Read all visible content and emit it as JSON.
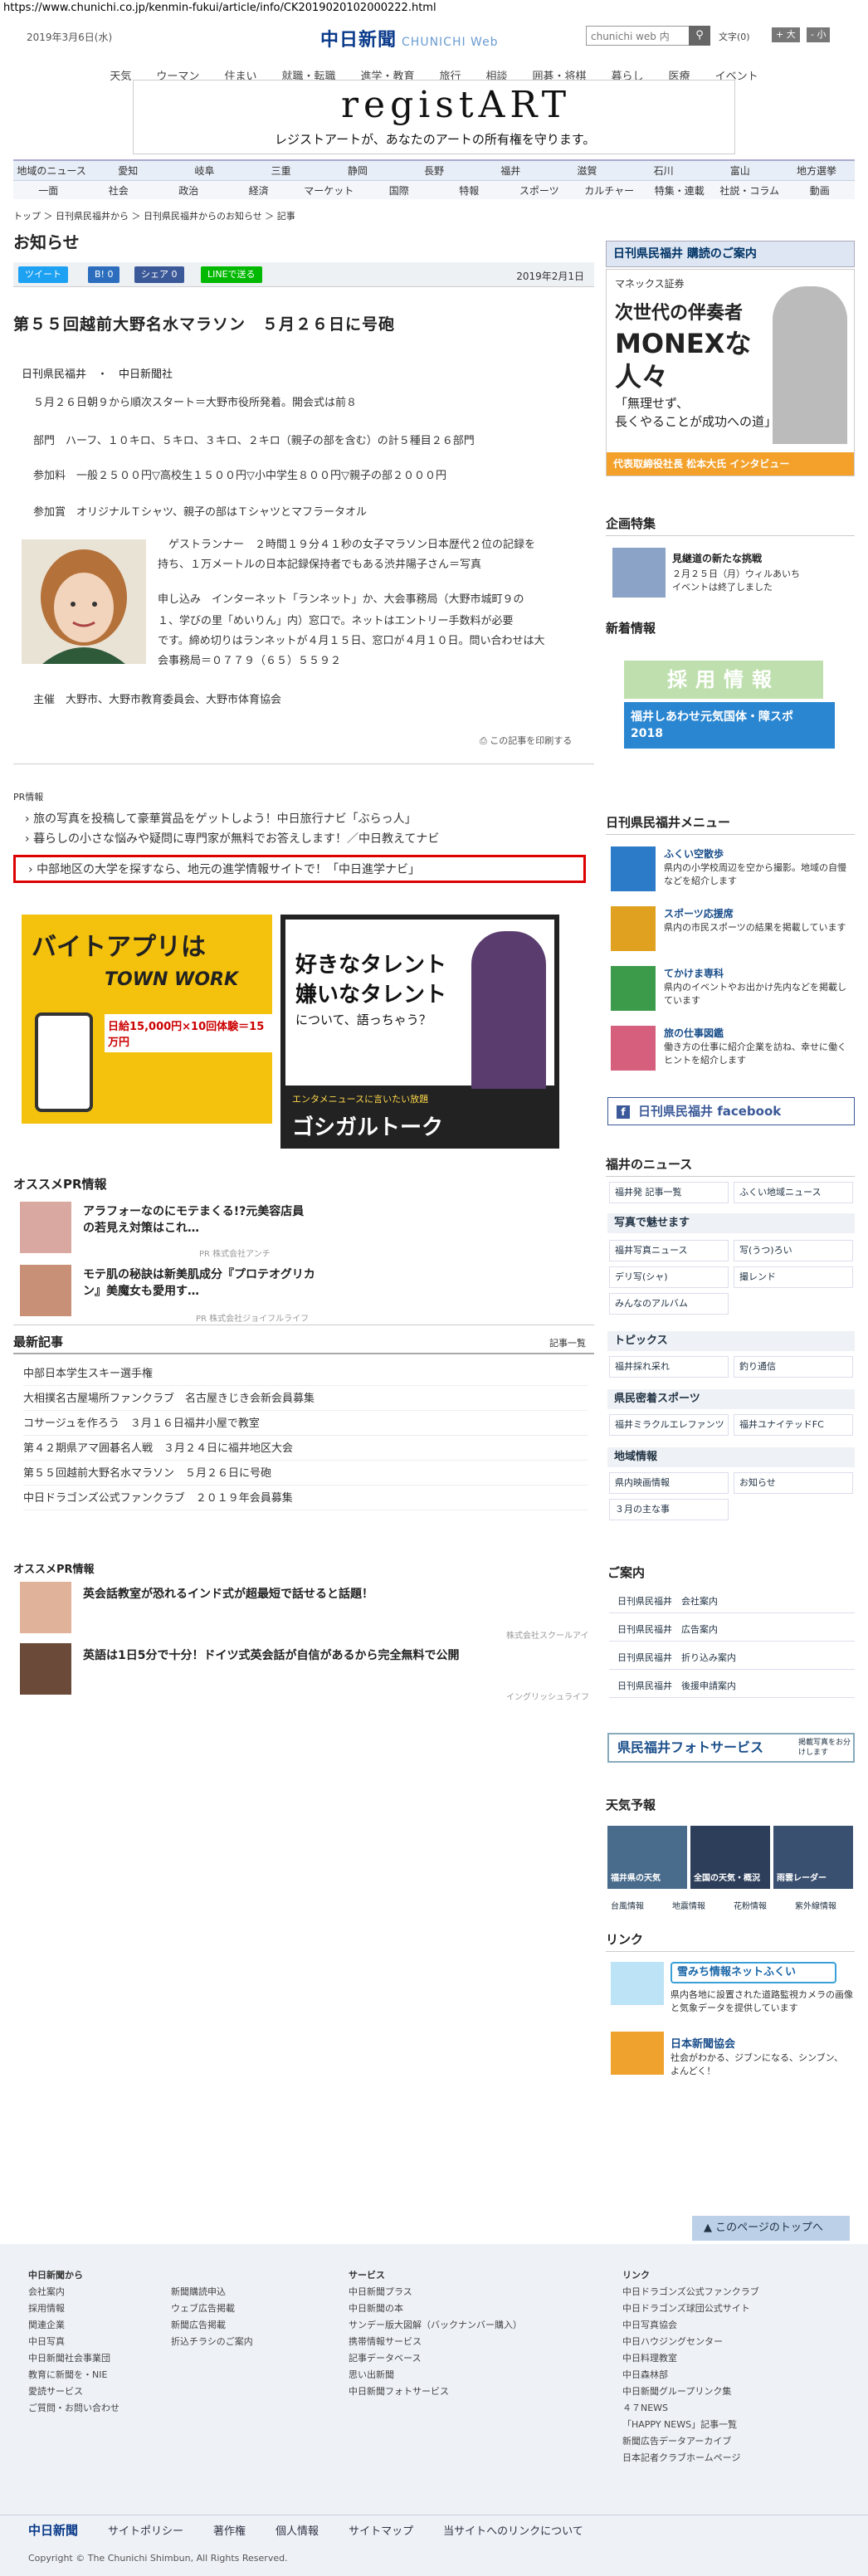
{
  "browser": {
    "url": "https://www.chunichi.co.jp/kenmin-fukui/article/info/CK2019020102000222.html"
  },
  "header": {
    "date": "2019年3月6日(水)",
    "logo": "中日新聞",
    "logo_sub": "CHUNICHI Web",
    "search_placeholder": "chunichi web 内",
    "font_label": "文字",
    "font_reset": "(0)",
    "font_big": "+ 大",
    "font_small": "- 小"
  },
  "gnav": [
    "天気",
    "ウーマン",
    "住まい",
    "就職・転職",
    "進学・教育",
    "旅行",
    "相談",
    "囲碁・将棋",
    "暮らし",
    "医療",
    "イベント"
  ],
  "ad": {
    "brand": "registART",
    "tagline": "レジストアートが、あなたのアートの所有権を守ります。"
  },
  "nav2_row1": [
    "地域のニュース",
    "愛知",
    "岐阜",
    "三重",
    "静岡",
    "長野",
    "福井",
    "滋賀",
    "石川",
    "富山",
    "地方選挙"
  ],
  "nav2_row2": [
    "一面",
    "社会",
    "政治",
    "経済",
    "マーケット",
    "国際",
    "特報",
    "スポーツ",
    "カルチャー",
    "特集・連載",
    "社説・コラム",
    "動画"
  ],
  "breadcrumb": "トップ ＞ 日刊県民福井から ＞ 日刊県民福井からのお知らせ ＞ 記事",
  "page_title": "お知らせ",
  "share": {
    "tweet": "ツイート",
    "b": "B! 0",
    "fb": "シェア 0",
    "line": "LINEで送る",
    "date": "2019年2月1日"
  },
  "article": {
    "headline": "第５５回越前大野名水マラソン　５月２６日に号砲",
    "source": "日刊県民福井　・　中日新聞社",
    "p1": "５月２６日朝９から順次スタート＝大野市役所発着。開会式は前８",
    "p2": "部門　ハーフ、１０キロ、５キロ、３キロ、２キロ（親子の部を含む）の計５種目２６部門",
    "p3": "参加料　一般２５００円▽高校生１５００円▽小中学生８００円▽親子の部２０００円",
    "p4": "参加賞　オリジナルＴシャツ、親子の部はＴシャツとマフラータオル",
    "c1": "　ゲストランナー　２時間１９分４１秒の女子マラソン日本歴代２位の記録を",
    "c2": "持ち、１万メートルの日本記録保持者でもある渋井陽子さん＝写真",
    "c3": "申し込み　インターネット「ランネット」か、大会事務局（大野市城町９の",
    "c4": "１、学びの里「めいりん」内）窓口で。ネットはエントリー手数料が必要",
    "c5": "です。締め切りはランネットが４月１５日、窓口が４月１０日。問い合わせは大",
    "c6": "会事務局＝０７７９（６５）５５９２",
    "sponsor": "主催　大野市、大野市教育委員会、大野市体育協会",
    "print": "この記事を印刷する"
  },
  "pr": {
    "label": "PR情報",
    "links": [
      "旅の写真を投稿して豪華賞品をゲットしよう！中日旅行ナビ「ぶらっ人」",
      "暮らしの小さな悩みや疑問に専門家が無料でお答えします！／中日教えてナビ",
      "中部地区の大学を探すなら、地元の進学情報サイトで！「中日進学ナビ」"
    ]
  },
  "banner1": {
    "title": "バイトアプリは",
    "brand": "TOWN WORK",
    "text": "日給15,000円×10回体験＝15万円"
  },
  "banner2": {
    "line1": "好きなタレント",
    "line2": "嫌いなタレント",
    "line3": "について、語っちゃう？",
    "sub": "エンタメニュースに言いたい放題",
    "brand": "ゴシガルトーク"
  },
  "osusume1": {
    "title": "オススメPR情報",
    "items": [
      {
        "text": "アラフォーなのにモテまくる!?元美容店員の若見え対策はこれ…",
        "src": "PR 株式会社アンチ"
      },
      {
        "text": "モテ肌の秘訣は新美肌成分『プロテオグリカン』美魔女も愛用す…",
        "src": "PR 株式会社ジョイフルライフ"
      }
    ]
  },
  "latest": {
    "title": "最新記事",
    "more": "記事一覧",
    "items": [
      "中部日本学生スキー選手権",
      "大相撲名古屋場所ファンクラブ　名古屋きじき会新会員募集",
      "コサージュを作ろう　３月１６日福井小屋で教室",
      "第４２期県アマ囲碁名人戦　３月２４日に福井地区大会",
      "第５５回越前大野名水マラソン　５月２６日に号砲",
      "中日ドラゴンズ公式ファンクラブ　２０１９年会員募集"
    ]
  },
  "osusume2": {
    "title": "オススメPR情報",
    "items": [
      {
        "text": "英会話教室が恐れるインド式が超最短で話せると話題！",
        "src": "株式会社スクールアイ"
      },
      {
        "text": "英語は1日5分で十分！ドイツ式英会話が自信があるから完全無料で公開",
        "src": "イングリッシュライフ"
      }
    ]
  },
  "side": {
    "subscribe": "日刊県民福井 購読のご案内",
    "monex": {
      "brand": "マネックス証券",
      "l1": "次世代の伴奏者",
      "l2": "MONEXな",
      "l3": "人々",
      "l4": "「無理せず、",
      "l5": "長くやることが成功への道」",
      "l6": "代表取締役社長 松本大氏 インタビュー"
    },
    "kikaku": {
      "title": "企画特集",
      "name": "見継道の新たな挑戦",
      "desc": "２月２５日（月）ウィルあいち　イベントは終了しました"
    },
    "shinchaku": "新着情報",
    "saiyo": "採用情報",
    "kokutai": "福井しあわせ元気国体・障スポ 2018",
    "menu": {
      "title": "日刊県民福井メニュー",
      "items": [
        {
          "t": "ふくい空散歩",
          "d": "県内の小学校周辺を空から撮影。地域の自慢などを紹介します"
        },
        {
          "t": "スポーツ応援席",
          "d": "県内の市民スポーツの結果を掲載しています"
        },
        {
          "t": "てかけま専科",
          "d": "県内のイベントやお出かけ先内などを掲載しています"
        },
        {
          "t": "旅の仕事図鑑",
          "d": "働き方の仕事に紹介企業を訪ね、幸せに働くヒントを紹介します"
        }
      ]
    },
    "facebook": "日刊県民福井 facebook",
    "fukui_news": "福井のニュース",
    "fn_items": [
      "福井発 記事一覧",
      "ふくい地域ニュース"
    ],
    "photo_title": "写真で魅せます",
    "photo_items": [
      "福井写真ニュース",
      "写(うつ)ろい",
      "デリ写(シャ)",
      "撮レンド",
      "みんなのアルバム"
    ],
    "topics": "トピックス",
    "topics_items": [
      "福井採れ采れ",
      "釣り通信"
    ],
    "sports": "県民密着スポーツ",
    "sports_items": [
      "福井ミラクルエレファンツ",
      "福井ユナイテッドFC"
    ],
    "chiiki": "地域情報",
    "chiiki_items": [
      "県内映画情報",
      "お知らせ",
      "３月の主な事"
    ],
    "annai": "ご案内",
    "annai_items": [
      "日刊県民福井　会社案内",
      "日刊県民福井　広告案内",
      "日刊県民福井　折り込み案内",
      "日刊県民福井　後援申請案内"
    ],
    "photo_service": "県民福井フォトサービス",
    "photo_service_sub": "掲載写真をお分けします",
    "tenki": "天気予報",
    "tenki_items": [
      "福井県の天気",
      "全国の天気・概況",
      "雨雲レーダー"
    ],
    "tenki_links": [
      "台風情報",
      "地震情報",
      "花粉情報",
      "紫外線情報"
    ],
    "link": "リンク",
    "yuki": "雪みち情報ネットふくい",
    "yuki_d": "県内各地に設置された道路監視カメラの画像と気象データを提供しています",
    "nihon": "日本新聞協会",
    "nihon_d": "社会がわかる、ジブンになる、シンブン、よんどく！"
  },
  "pagetop": "このページのトップへ",
  "footer": {
    "c1_title": "中日新聞から",
    "c1": [
      "会社案内",
      "採用情報",
      "関連企業",
      "中日写真",
      "中日新聞社会事業団",
      "教育に新聞を・NIE",
      "愛読サービス",
      "ご質問・お問い合わせ"
    ],
    "c2": [
      "新聞購読申込",
      "ウェブ広告掲載",
      "新聞広告掲載",
      "折込チラシのご案内"
    ],
    "c3_title": "サービス",
    "c3": [
      "中日新聞プラス",
      "中日新聞の本",
      "サンデー版大図解（バックナンバー購入）",
      "携帯情報サービス",
      "記事データベース",
      "思い出新聞",
      "中日新聞フォトサービス"
    ],
    "c4_title": "リンク",
    "c4": [
      "中日ドラゴンズ公式ファンクラブ",
      "中日ドラゴンズ球団公式サイト",
      "中日写真協会",
      "中日ハウジングセンター",
      "中日料理教室",
      "中日森林部",
      "中日新聞グループリンク集",
      "４７NEWS",
      "「HAPPY NEWS」記事一覧",
      "新聞広告データアーカイブ",
      "日本記者クラブホームページ"
    ],
    "bar": [
      "中日新聞",
      "サイトポリシー",
      "著作権",
      "個人情報",
      "サイトマップ",
      "当サイトへのリンクについて"
    ],
    "copyright": "Copyright © The Chunichi Shimbun, All Rights Reserved."
  },
  "colors": {
    "nav_bg": "#e8eef7",
    "accent": "#0a3a8a",
    "red_box": "#dd0000"
  }
}
